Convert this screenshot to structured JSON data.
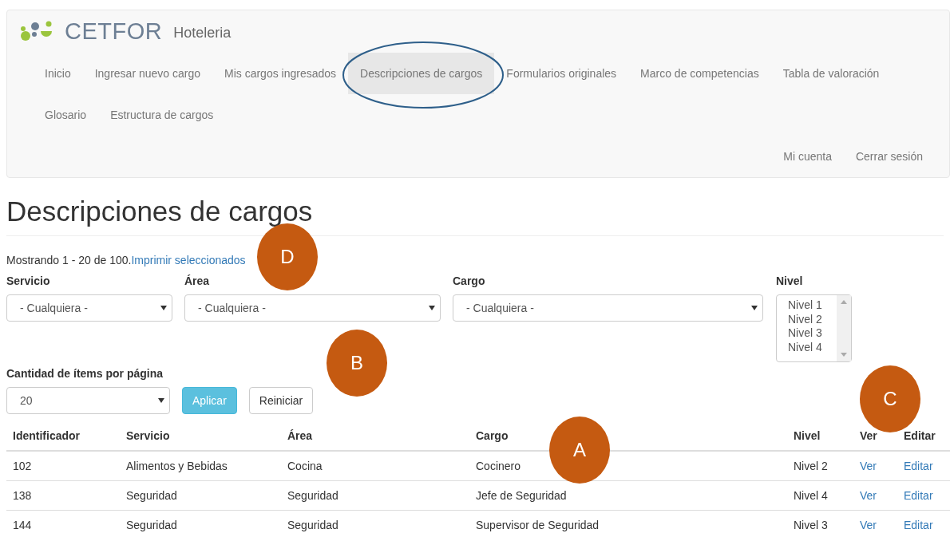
{
  "header": {
    "brand": "CETFOR",
    "subtitle": "Hoteleria"
  },
  "nav": [
    {
      "label": "Inicio",
      "selected": false
    },
    {
      "label": "Ingresar nuevo cargo",
      "selected": false
    },
    {
      "label": "Mis cargos ingresados",
      "selected": false
    },
    {
      "label": "Descripciones de cargos",
      "selected": true
    },
    {
      "label": "Formularios originales",
      "selected": false
    },
    {
      "label": "Marco de competencias",
      "selected": false
    },
    {
      "label": "Tabla de valoración",
      "selected": false
    },
    {
      "label": "Glosario",
      "selected": false
    },
    {
      "label": "Estructura de cargos",
      "selected": false
    }
  ],
  "account_nav": [
    "Mi cuenta",
    "Cerrar sesión"
  ],
  "page_title": "Descripciones de cargos",
  "summary": {
    "text": "Mostrando 1 - 20 de 100.",
    "link": "Imprimir seleccionados"
  },
  "filters": [
    {
      "label": "Servicio",
      "value": "- Cualquiera -"
    },
    {
      "label": "Área",
      "value": "- Cualquiera -"
    },
    {
      "label": "Cargo",
      "value": "- Cualquiera -"
    }
  ],
  "level_filter": {
    "label": "Nivel",
    "options": [
      "Nivel 1",
      "Nivel 2",
      "Nivel 3",
      "Nivel 4"
    ]
  },
  "per_page": {
    "label": "Cantidad de ítems por página",
    "value": "20"
  },
  "buttons": {
    "apply": "Aplicar",
    "reset": "Reiniciar"
  },
  "table": {
    "columns": [
      "Identificador",
      "Servicio",
      "Área",
      "Cargo",
      "Nivel",
      "Ver",
      "Editar"
    ],
    "rows": [
      {
        "id": "102",
        "servicio": "Alimentos y Bebidas",
        "area": "Cocina",
        "cargo": "Cocinero",
        "nivel": "Nivel 2",
        "ver": "Ver",
        "editar": "Editar"
      },
      {
        "id": "138",
        "servicio": "Seguridad",
        "area": "Seguridad",
        "cargo": "Jefe de Seguridad",
        "nivel": "Nivel 4",
        "ver": "Ver",
        "editar": "Editar"
      },
      {
        "id": "144",
        "servicio": "Seguridad",
        "area": "Seguridad",
        "cargo": "Supervisor de Seguridad",
        "nivel": "Nivel 3",
        "ver": "Ver",
        "editar": "Editar"
      }
    ]
  },
  "annotations": [
    {
      "label": "D"
    },
    {
      "label": "B"
    },
    {
      "label": "C"
    },
    {
      "label": "A"
    }
  ]
}
